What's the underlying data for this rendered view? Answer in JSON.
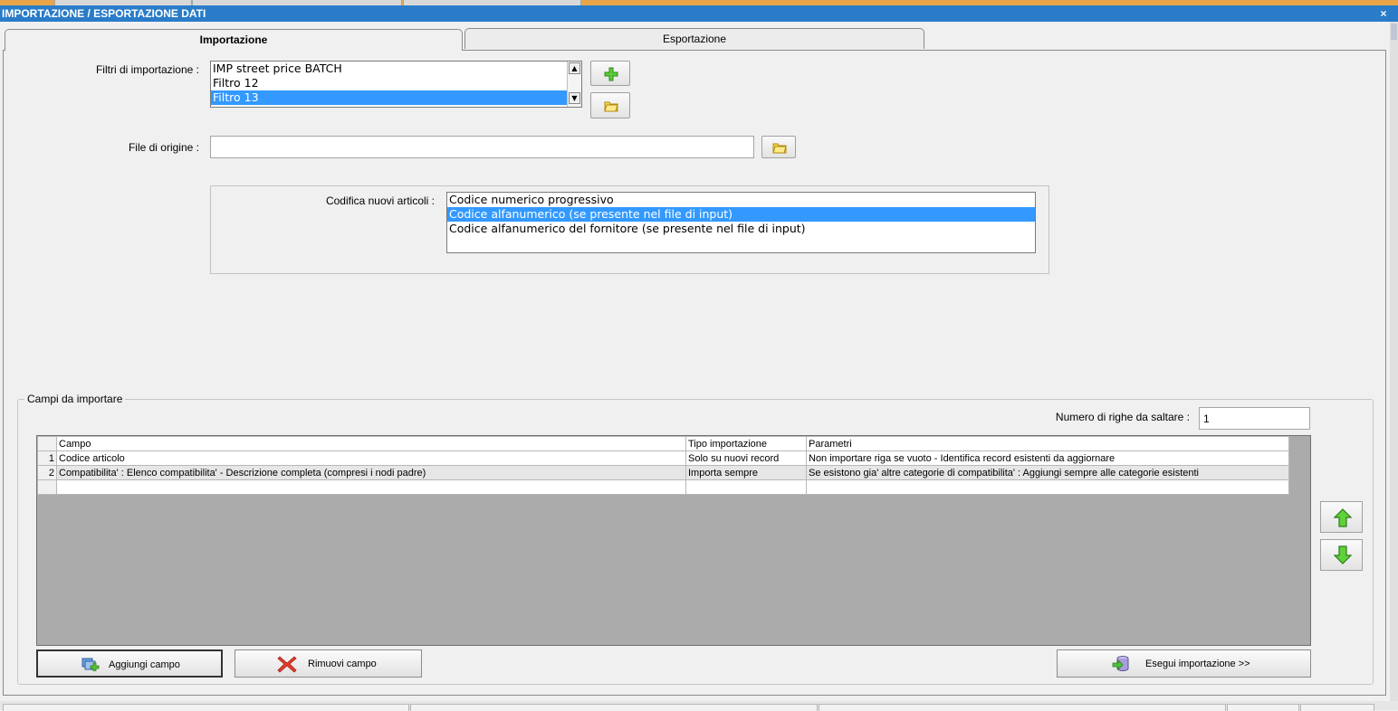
{
  "window": {
    "title": "IMPORTAZIONE / ESPORTAZIONE DATI",
    "close_glyph": "×"
  },
  "tabs": [
    {
      "label": "Importazione",
      "active": true
    },
    {
      "label": "Esportazione",
      "active": false
    }
  ],
  "filters": {
    "label": "Filtri di importazione :",
    "items": [
      "IMP street price BATCH",
      "Filtro 12",
      "Filtro 13"
    ],
    "selected": "Filtro 13",
    "add_icon": "plus-icon",
    "open_icon": "folder-icon"
  },
  "source_file": {
    "label": "File di origine :",
    "value": "",
    "browse_icon": "folder-icon"
  },
  "coding": {
    "label": "Codifica nuovi articoli :",
    "options": [
      "Codice numerico progressivo",
      "Codice alfanumerico (se presente nel file di input)",
      "Codice alfanumerico del fornitore (se presente nel file di input)"
    ],
    "selected": "Codice alfanumerico (se presente nel file di input)"
  },
  "fields_group": {
    "legend": "Campi da importare",
    "skip_rows_label": "Numero di righe da saltare  :",
    "skip_rows_value": "1",
    "columns": [
      "Campo",
      "Tipo importazione",
      "Parametri"
    ],
    "rows": [
      {
        "num": "1",
        "campo": "Codice articolo",
        "tipo": "Solo su nuovi record",
        "parametri": "Non importare riga se vuoto - Identifica record esistenti da aggiornare"
      },
      {
        "num": "2",
        "campo": "Compatibilita' : Elenco compatibilita' - Descrizione completa (compresi i nodi padre)",
        "tipo": "Importa sempre",
        "parametri": "Se esistono gia' altre categorie di compatibilita' : Aggiungi sempre alle categorie esistenti"
      }
    ]
  },
  "buttons": {
    "add_field": "Aggiungi campo",
    "remove_field": "Rimuovi campo",
    "run_import": "Esegui importazione >>",
    "move_up_icon": "arrow-up-icon",
    "move_down_icon": "arrow-down-icon"
  },
  "colors": {
    "title_bar": "#2a7cc8",
    "selection": "#3399ff",
    "grid_background": "#ababab",
    "accent_orange": "#e8a54a"
  }
}
